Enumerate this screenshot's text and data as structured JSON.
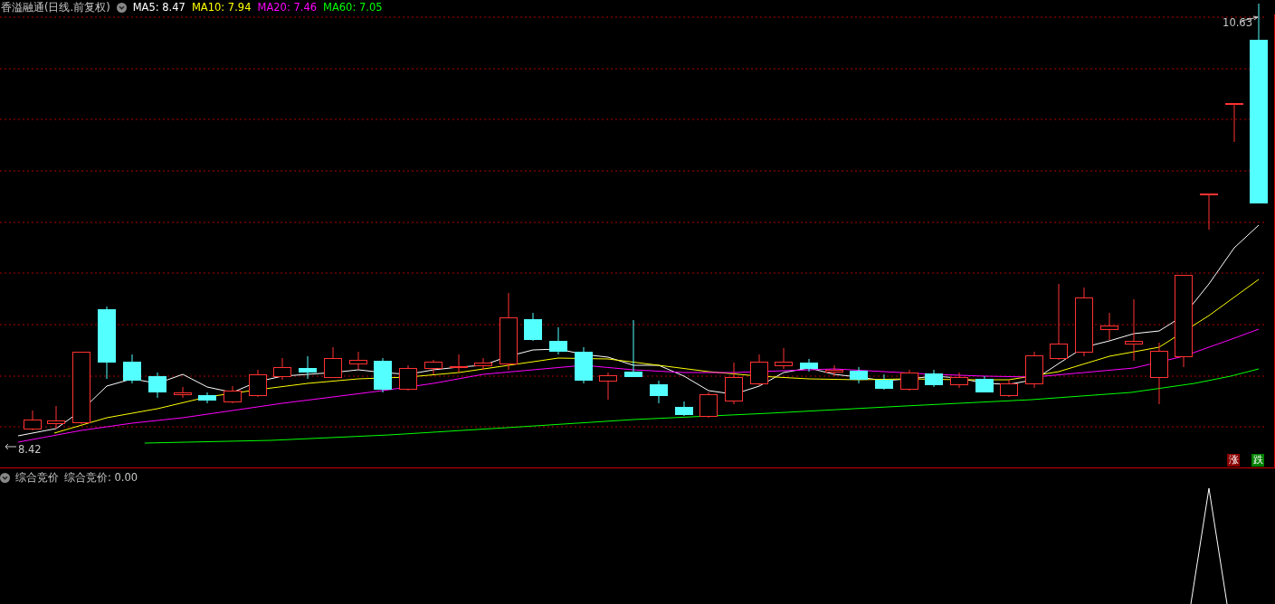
{
  "legend": {
    "title": "香溢融通(日线.前复权)",
    "indicators": [
      {
        "text": "MA5: 8.47",
        "color": "#ffffff"
      },
      {
        "text": "MA10: 7.94",
        "color": "#ffff00"
      },
      {
        "text": "MA20: 7.46",
        "color": "#ff00ff"
      },
      {
        "text": "MA60: 7.05",
        "color": "#00ff00"
      }
    ]
  },
  "price_chart": {
    "high_marker": "10.63",
    "low_marker": "8.42",
    "rise_button": "涨",
    "fall_button": "跌"
  },
  "sub_panel": {
    "title": "综合竞价",
    "reading": "综合竞价: 0.00"
  }
}
